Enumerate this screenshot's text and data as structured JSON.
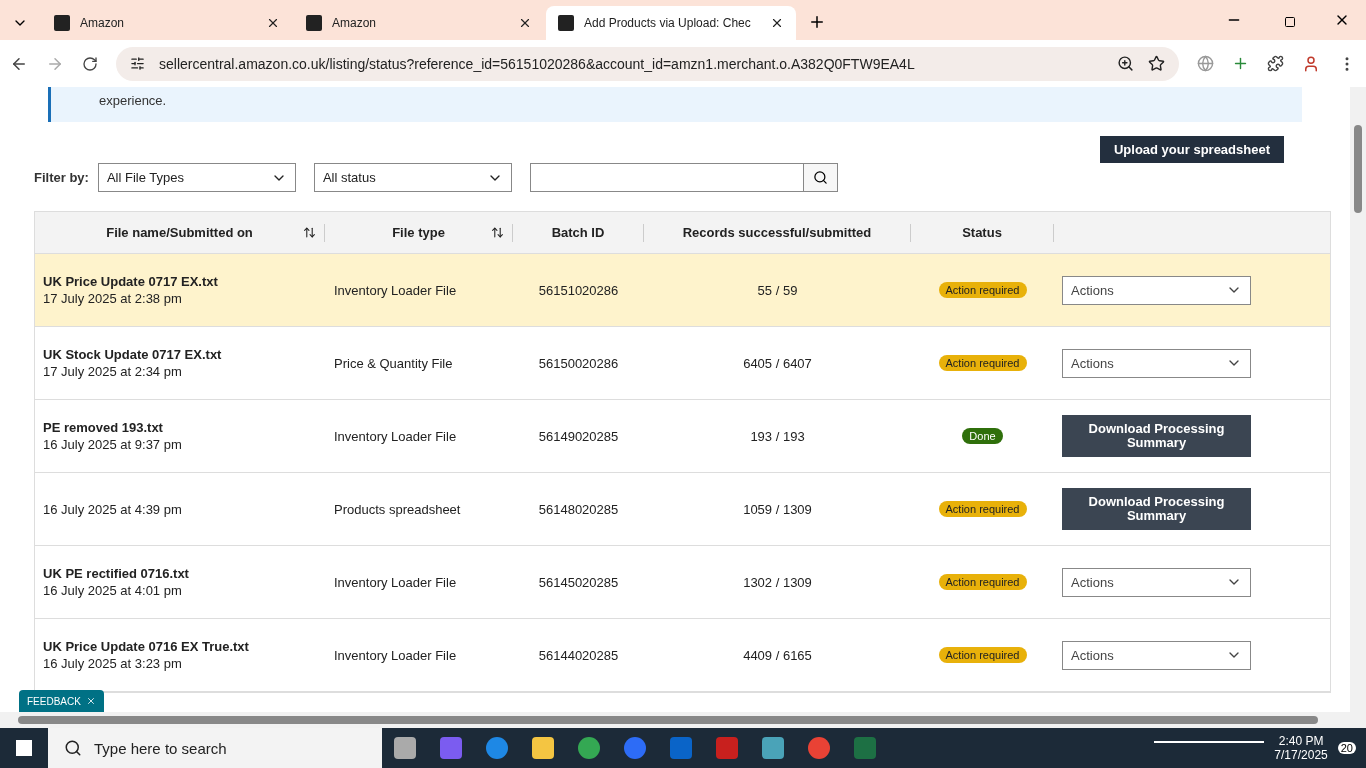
{
  "browser": {
    "tabs": [
      {
        "title": "Amazon",
        "selected": false
      },
      {
        "title": "Amazon",
        "selected": false
      },
      {
        "title": "Add Products via Upload: Chec",
        "selected": true
      }
    ],
    "address": "sellercentral.amazon.co.uk/listing/status?reference_id=56151020286&account_id=amzn1.merchant.o.A382Q0FTW9EA4L"
  },
  "banner": {
    "text": "experience."
  },
  "upload_button": "Upload your spreadsheet",
  "filter": {
    "label": "Filter by:",
    "file_type": "All File Types",
    "status": "All status"
  },
  "table": {
    "columns": [
      {
        "label": "File name/Submitted on",
        "sortable": true
      },
      {
        "label": "File type",
        "sortable": true
      },
      {
        "label": "Batch ID",
        "sortable": false
      },
      {
        "label": "Records successful/submitted",
        "sortable": false
      },
      {
        "label": "Status",
        "sortable": false
      }
    ],
    "rows": [
      {
        "name": "UK Price Update 0717 EX.txt",
        "date": "17 July 2025 at 2:38 pm",
        "type": "Inventory Loader File",
        "batch": "56151020286",
        "records": "55 / 59",
        "status": {
          "kind": "action",
          "label": "Action required"
        },
        "action": {
          "kind": "dropdown",
          "label": "Actions"
        },
        "selected": true
      },
      {
        "name": "UK Stock Update 0717 EX.txt",
        "date": "17 July 2025 at 2:34 pm",
        "type": "Price & Quantity File",
        "batch": "56150020286",
        "records": "6405 / 6407",
        "status": {
          "kind": "action",
          "label": "Action required"
        },
        "action": {
          "kind": "dropdown",
          "label": "Actions"
        },
        "selected": false
      },
      {
        "name": "PE removed 193.txt",
        "date": "16 July 2025 at 9:37 pm",
        "type": "Inventory Loader File",
        "batch": "56149020285",
        "records": "193 / 193",
        "status": {
          "kind": "done",
          "label": "Done"
        },
        "action": {
          "kind": "button",
          "label": "Download Processing Summary"
        },
        "selected": false
      },
      {
        "date": "16 July 2025 at 4:39 pm",
        "type": "Products spreadsheet",
        "batch": "56148020285",
        "records": "1059 / 1309",
        "status": {
          "kind": "action",
          "label": "Action required"
        },
        "action": {
          "kind": "button",
          "label": "Download Processing Summary"
        },
        "selected": false
      },
      {
        "name": "UK PE rectified 0716.txt",
        "date": "16 July 2025 at 4:01 pm",
        "type": "Inventory Loader File",
        "batch": "56145020285",
        "records": "1302 / 1309",
        "status": {
          "kind": "action",
          "label": "Action required"
        },
        "action": {
          "kind": "dropdown",
          "label": "Actions"
        },
        "selected": false
      },
      {
        "name": "UK Price Update 0716 EX True.txt",
        "date": "16 July 2025 at 3:23 pm",
        "type": "Inventory Loader File",
        "batch": "56144020285",
        "records": "4409 / 6165",
        "status": {
          "kind": "action",
          "label": "Action required"
        },
        "action": {
          "kind": "dropdown",
          "label": "Actions"
        },
        "selected": false
      }
    ]
  },
  "feedback": "FEEDBACK",
  "taskbar": {
    "search_placeholder": "Type here to search",
    "time": "2:40 PM",
    "date": "7/17/2025",
    "notifications": "20"
  }
}
